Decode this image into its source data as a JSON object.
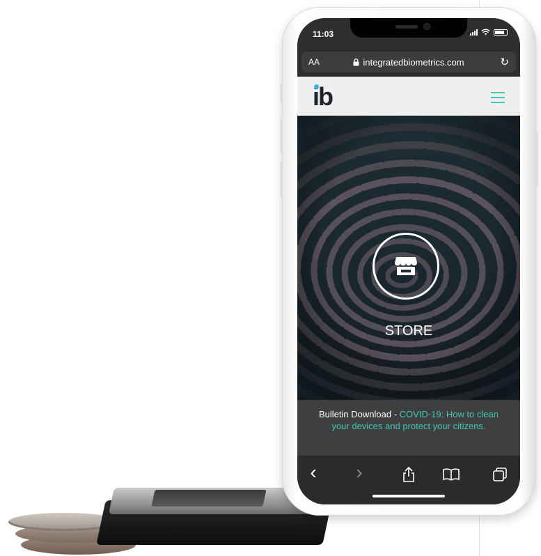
{
  "statusbar": {
    "time": "11:03"
  },
  "browser": {
    "text_size_label": "AA",
    "url": "integratedbiometrics.com",
    "reload_glyph": "↻"
  },
  "site": {
    "logo_text": "ib",
    "accent_color": "#3ec9b0"
  },
  "hero": {
    "label": "STORE"
  },
  "bulletin": {
    "prefix": "Bulletin Download - ",
    "link_text": "COVID-19: How to clean your devices and protect your citizens."
  },
  "toolbar": {
    "back": "‹",
    "forward": "›",
    "share_icon": "share-icon",
    "bookmarks_icon": "book-icon",
    "tabs_icon": "tabs-icon"
  }
}
